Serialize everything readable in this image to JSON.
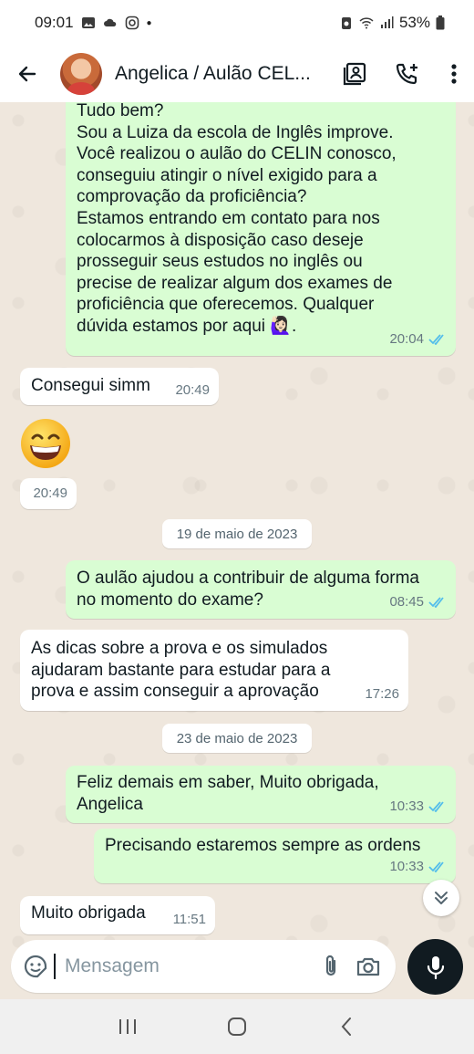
{
  "status_bar": {
    "time": "09:01",
    "battery": "53%"
  },
  "header": {
    "title": "Angelica / Aulão CEL..."
  },
  "messages": [
    {
      "dir": "out",
      "text": "Tudo bem?\nSou a Luiza da escola de Inglês improve.\nVocê realizou o aulão do CELIN conosco,\nconseguiu atingir o nível exigido para a\ncomprovação da proficiência?\nEstamos entrando em contato para nos\ncolocarmos à disposição caso deseje\nprosseguir seus estudos no inglês ou\nprecise de realizar algum dos exames de\nproficiência que oferecemos. Qualquer\ndúvida estamos por aqui 🙋🏻‍♀️.",
      "time": "20:04"
    },
    {
      "dir": "in",
      "text": "Consegui simm",
      "time": "20:49"
    },
    {
      "dir": "in",
      "emoji": "😄",
      "time": "20:49"
    },
    {
      "dir": "out",
      "text": "O aulão ajudou a contribuir de alguma forma\nno momento do exame?",
      "time": "08:45"
    },
    {
      "dir": "in",
      "text": "As dicas sobre a prova e os simulados\najudaram bastante para estudar para a\nprova e assim conseguir a aprovação",
      "time": "17:26"
    },
    {
      "dir": "out",
      "text": "Feliz demais em saber, Muito obrigada,\nAngelica",
      "time": "10:33"
    },
    {
      "dir": "out",
      "text": "Precisando estaremos sempre as ordens",
      "time": "10:33"
    },
    {
      "dir": "in",
      "text": "Muito obrigada",
      "time": "11:51"
    }
  ],
  "date_dividers": [
    "19 de maio de 2023",
    "23 de maio de 2023"
  ],
  "composer": {
    "placeholder": "Mensagem"
  },
  "colors": {
    "outgoing": "#d9fdd3",
    "incoming": "#ffffff",
    "read_ticks": "#53bdeb",
    "mic_button": "#111b21"
  },
  "icons": [
    "back-arrow-icon",
    "contact-card-icon",
    "add-call-icon",
    "more-vert-icon",
    "sticker-icon",
    "attach-icon",
    "camera-icon",
    "mic-icon",
    "chevrons-down-icon"
  ]
}
